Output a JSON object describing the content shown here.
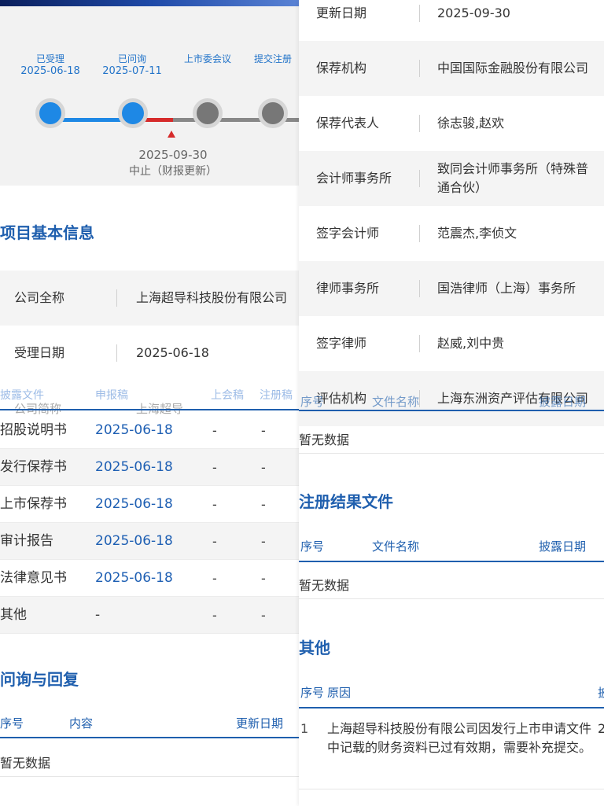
{
  "timeline": {
    "milestones": [
      {
        "label": "已受理",
        "date": "2025-06-18"
      },
      {
        "label": "已问询",
        "date": "2025-07-11"
      },
      {
        "label": "上市委会议",
        "date": ""
      },
      {
        "label": "提交注册",
        "date": ""
      }
    ],
    "status_date": "2025-09-30",
    "status_text": "中止（财报更新）"
  },
  "basic_info": {
    "title": "项目基本信息",
    "rows": [
      {
        "key": "公司全称",
        "value": "上海超导科技股份有限公司"
      },
      {
        "key": "受理日期",
        "value": "2025-06-18"
      },
      {
        "key": "公司简称",
        "value": "上海超导"
      }
    ]
  },
  "documents": {
    "headers": [
      "披露文件",
      "申报稿",
      "上会稿",
      "注册稿"
    ],
    "rows": [
      {
        "name": "招股说明书",
        "date": "2025-06-18",
        "c2": "-",
        "c3": "-"
      },
      {
        "name": "发行保荐书",
        "date": "2025-06-18",
        "c2": "-",
        "c3": "-"
      },
      {
        "name": "上市保荐书",
        "date": "2025-06-18",
        "c2": "-",
        "c3": "-"
      },
      {
        "name": "审计报告",
        "date": "2025-06-18",
        "c2": "-",
        "c3": "-"
      },
      {
        "name": "法律意见书",
        "date": "2025-06-18",
        "c2": "-",
        "c3": "-"
      },
      {
        "name": "其他",
        "date": "-",
        "c2": "-",
        "c3": "-"
      }
    ]
  },
  "inquiry": {
    "title": "问询与回复",
    "headers": [
      "序号",
      "内容",
      "更新日期"
    ],
    "empty": "暂无数据"
  },
  "right_info": {
    "rows": [
      {
        "key": "更新日期",
        "value": "2025-09-30"
      },
      {
        "key": "保荐机构",
        "value": "中国国际金融股份有限公司"
      },
      {
        "key": "保荐代表人",
        "value": "徐志骏,赵欢"
      },
      {
        "key": "会计师事务所",
        "value": "致同会计师事务所（特殊普通合伙）"
      },
      {
        "key": "签字会计师",
        "value": "范震杰,李侦文"
      },
      {
        "key": "律师事务所",
        "value": "国浩律师（上海）事务所"
      },
      {
        "key": "签字律师",
        "value": "赵威,刘中贵"
      },
      {
        "key": "评估机构",
        "value": "上海东洲资产评估有限公司"
      }
    ],
    "overlap_headers": [
      "序号",
      "文件名称",
      "披露日期"
    ]
  },
  "pre_section": {
    "empty": "暂无数据"
  },
  "registration": {
    "title": "注册结果文件",
    "headers": [
      "序号",
      "文件名称",
      "披露日期"
    ],
    "empty": "暂无数据"
  },
  "other": {
    "title": "其他",
    "headers": [
      "序号",
      "原因",
      "披"
    ],
    "rows": [
      {
        "index": "1",
        "reason": "上海超导科技股份有限公司因发行上市申请文件中记载的财务资料已过有效期，需要补充提交。",
        "date_fragment": "2"
      }
    ]
  },
  "colors": {
    "accent": "#1f5fae",
    "link": "#2374c9",
    "milestone_active": "#1e88e5",
    "milestone_pending": "#777777",
    "marker": "#d62b2b"
  }
}
